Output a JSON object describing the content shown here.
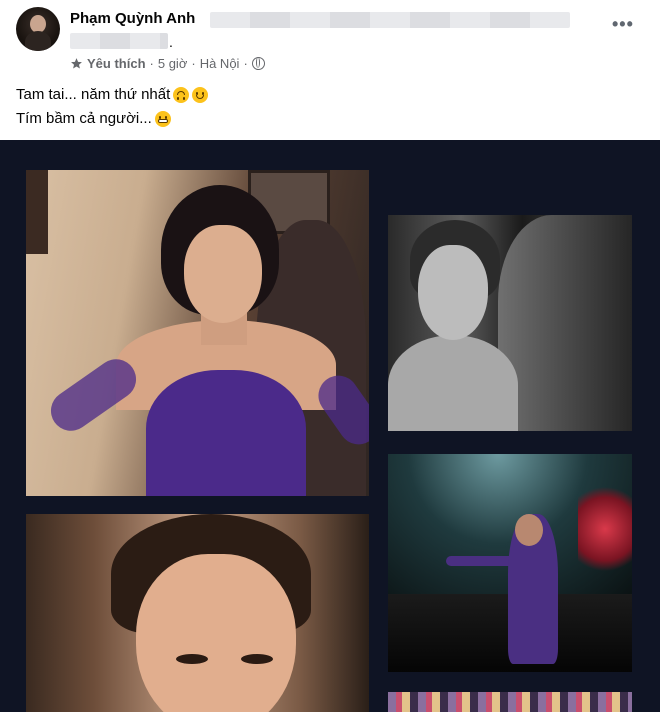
{
  "post": {
    "author": "Phạm Quỳnh Anh",
    "trailing_dot": ".",
    "more_label": "•••",
    "favorite_label": "Yêu thích",
    "separator": "·",
    "time": "5 giờ",
    "location": "Hà Nội",
    "line1": "Tam tai... năm thứ nhất",
    "line2": "Tím bầm cả người..."
  },
  "icons": {
    "star": "star-icon",
    "globe": "globe-icon",
    "more": "more-options-icon",
    "emoji_line1": [
      "upside-down-face-icon",
      "smiling-face-icon"
    ],
    "emoji_line2": [
      "grimacing-face-icon"
    ]
  },
  "colors": {
    "photo_background": "#0f1424",
    "meta_text": "#65676b",
    "dress_purple": "#4b2a8a"
  }
}
